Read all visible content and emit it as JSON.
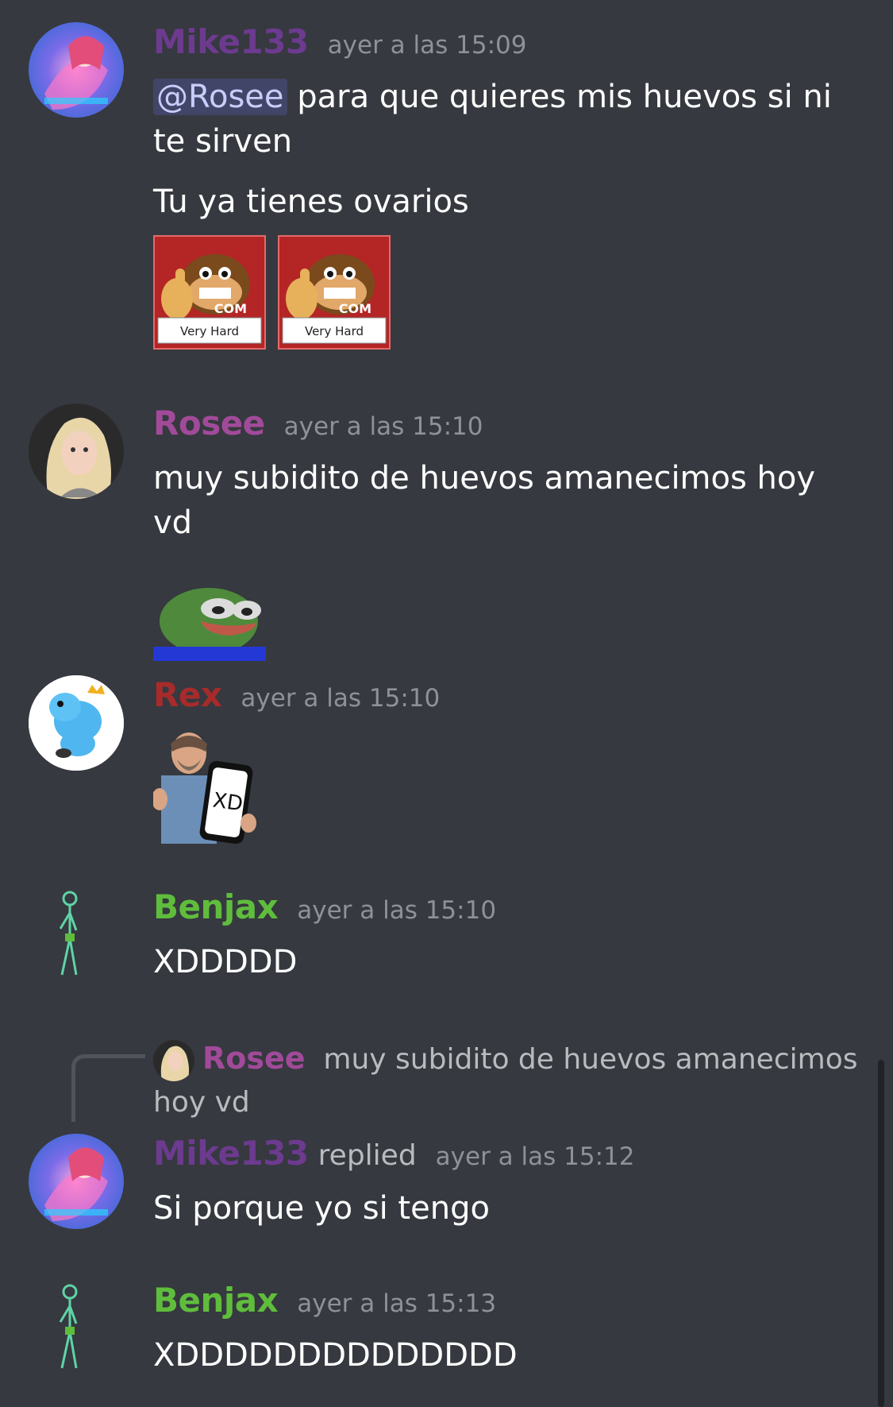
{
  "colors": {
    "background": "#36393f",
    "mike": "#6c3a8f",
    "rosee": "#a24a9a",
    "rex": "#a72b2b",
    "benjax": "#5fbd3c"
  },
  "messages": [
    {
      "username": "Mike133",
      "timestamp": "ayer a las 15:09",
      "mention": "@Rosee",
      "line1": " para que quieres mis huevos si ni te sirven",
      "line2": "Tu ya tienes ovarios",
      "emotes": [
        {
          "label": "Very Hard",
          "badge": "COM"
        },
        {
          "label": "Very Hard",
          "badge": "COM"
        }
      ]
    },
    {
      "username": "Rosee",
      "timestamp": "ayer a las 15:10",
      "text": "muy subidito de huevos amanecimos hoy vd"
    },
    {
      "username": "Rex",
      "timestamp": "ayer a las 15:10",
      "sticker_text": "XD"
    },
    {
      "username": "Benjax",
      "timestamp": "ayer a las 15:10",
      "text": "XDDDDD"
    },
    {
      "reply_to": {
        "username": "Rosee",
        "text": "muy subidito de huevos amanecimos hoy vd"
      },
      "username": "Mike133",
      "replied": "replied",
      "timestamp": "ayer a las 15:12",
      "text": "Si porque yo si tengo"
    },
    {
      "username": "Benjax",
      "timestamp": "ayer a las 15:13",
      "text": "XDDDDDDDDDDDDDD"
    }
  ]
}
